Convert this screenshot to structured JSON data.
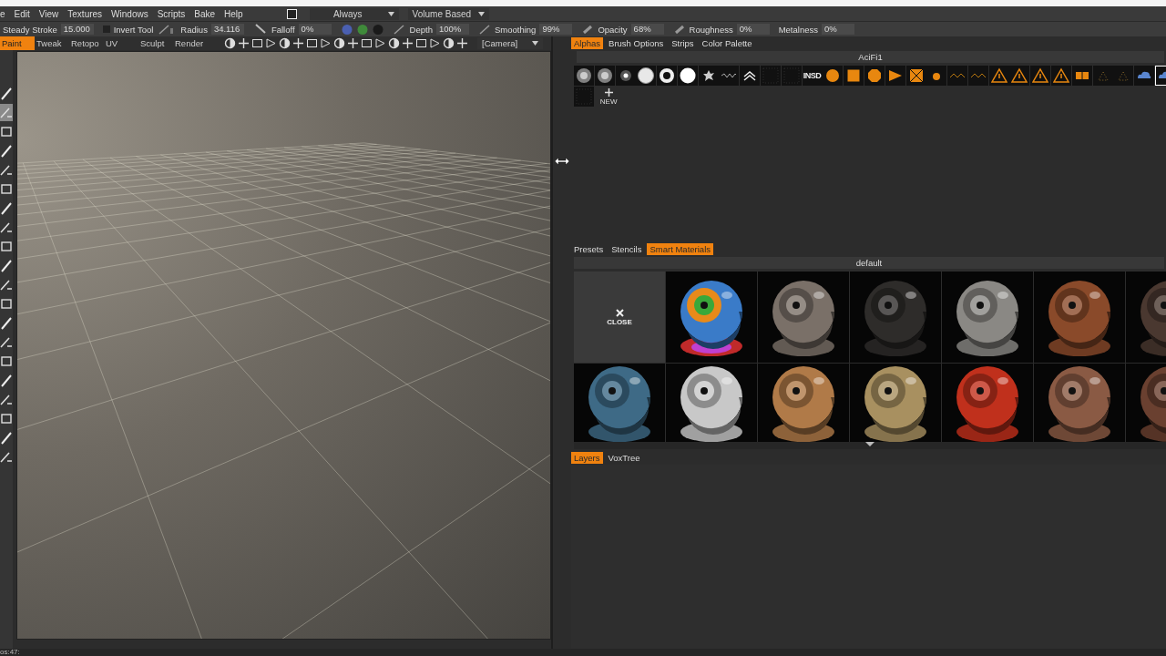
{
  "menu_bar": {
    "items": [
      "e",
      "Edit",
      "View",
      "Textures",
      "Windows",
      "Scripts",
      "Bake",
      "Help"
    ],
    "checkbox": {
      "checked": false
    },
    "dropdowns": [
      "Always",
      "Volume Based"
    ]
  },
  "tool_options": {
    "fields": [
      {
        "label": "Steady Stroke",
        "value": "15.000"
      },
      {
        "label": "Radius",
        "value": "34.116"
      },
      {
        "label": "Falloff",
        "value": "0%"
      },
      {
        "label": "Depth",
        "value": "100%"
      },
      {
        "label": "Smoothing",
        "value": "99%"
      },
      {
        "label": "Opacity",
        "value": "68%"
      },
      {
        "label": "Roughness",
        "value": "0%"
      },
      {
        "label": "Metalness",
        "value": "0%"
      }
    ],
    "invert": {
      "label": "Invert Tool",
      "checked": false
    }
  },
  "rooms": [
    {
      "label": "Paint",
      "selected": true
    },
    {
      "label": "Tweak",
      "selected": false
    },
    {
      "label": "Retopo",
      "selected": false
    },
    {
      "label": "UV",
      "selected": false
    },
    {
      "label": "Sculpt",
      "selected": false
    },
    {
      "label": "Render",
      "selected": false
    }
  ],
  "camera_dropdown": "[Camera]",
  "left_toolbar": {
    "tools": [
      {
        "selected": false
      },
      {
        "selected": true
      },
      {
        "selected": false
      },
      {
        "selected": false
      },
      {
        "selected": false
      },
      {
        "selected": false
      },
      {
        "selected": false
      },
      {
        "selected": false
      },
      {
        "selected": false
      },
      {
        "selected": false
      },
      {
        "selected": false
      },
      {
        "selected": false
      },
      {
        "selected": false
      },
      {
        "selected": false
      },
      {
        "selected": false
      },
      {
        "selected": false
      },
      {
        "selected": false
      },
      {
        "selected": false
      },
      {
        "selected": false
      },
      {
        "selected": false
      }
    ]
  },
  "panel_tabs": [
    {
      "label": "Alphas",
      "selected": true
    },
    {
      "label": "Brush Options",
      "selected": false
    },
    {
      "label": "Strips",
      "selected": false
    },
    {
      "label": "Color Palette",
      "selected": false
    }
  ],
  "alphas": {
    "title": "AciFi1",
    "thumbnails": [
      {
        "kind": "soft",
        "selected": false
      },
      {
        "kind": "soft",
        "selected": false
      },
      {
        "kind": "dot",
        "selected": false
      },
      {
        "kind": "sphere",
        "selected": false
      },
      {
        "kind": "ring",
        "selected": false
      },
      {
        "kind": "disc",
        "selected": false
      },
      {
        "kind": "splat",
        "selected": false
      },
      {
        "kind": "scribble",
        "selected": false
      },
      {
        "kind": "chevron",
        "selected": false
      },
      {
        "kind": "blank",
        "selected": false
      },
      {
        "kind": "blank",
        "selected": false
      },
      {
        "kind": "text",
        "text": "INSD",
        "selected": false
      },
      {
        "kind": "circle",
        "selected": false
      },
      {
        "kind": "square",
        "selected": false
      },
      {
        "kind": "octagon",
        "selected": false
      },
      {
        "kind": "triangle",
        "selected": false
      },
      {
        "kind": "crossbox",
        "selected": false
      },
      {
        "kind": "smalldot",
        "selected": false
      },
      {
        "kind": "stripes",
        "selected": false
      },
      {
        "kind": "stripes",
        "selected": false
      },
      {
        "kind": "warning",
        "selected": false
      },
      {
        "kind": "warning",
        "selected": false
      },
      {
        "kind": "warning",
        "selected": false
      },
      {
        "kind": "warning",
        "selected": false
      },
      {
        "kind": "plate",
        "selected": false
      },
      {
        "kind": "faint",
        "selected": false
      },
      {
        "kind": "faint",
        "selected": false
      },
      {
        "kind": "cloud",
        "selected": false
      },
      {
        "kind": "cloud",
        "selected": true
      }
    ],
    "extra": [
      {
        "kind": "blank",
        "selected": false
      }
    ],
    "new_label": "NEW"
  },
  "library_tabs": [
    {
      "label": "Presets",
      "selected": false
    },
    {
      "label": "Stencils",
      "selected": false
    },
    {
      "label": "Smart Materials",
      "selected": true
    }
  ],
  "materials": {
    "folder": "default",
    "cells": [
      {
        "kind": "close",
        "label": "CLOSE"
      },
      {
        "kind": "layered",
        "color": "#3a7bc8"
      },
      {
        "kind": "material",
        "color": "#7a7068"
      },
      {
        "kind": "material",
        "color": "#2e2c2a"
      },
      {
        "kind": "material",
        "color": "#8a8884"
      },
      {
        "kind": "material",
        "color": "#8a4a2a"
      },
      {
        "kind": "material",
        "color": "#4a3830"
      },
      {
        "kind": "material",
        "color": "#3e6a86"
      },
      {
        "kind": "material",
        "color": "#c8c8c8"
      },
      {
        "kind": "material",
        "color": "#b07a48"
      },
      {
        "kind": "material",
        "color": "#a89060"
      },
      {
        "kind": "material",
        "color": "#c0301c"
      },
      {
        "kind": "material",
        "color": "#8a5a44"
      },
      {
        "kind": "material",
        "color": "#6a4030"
      }
    ]
  },
  "layer_tabs": [
    {
      "label": "Layers",
      "selected": true
    },
    {
      "label": "VoxTree",
      "selected": false
    }
  ],
  "status": "os:47:"
}
